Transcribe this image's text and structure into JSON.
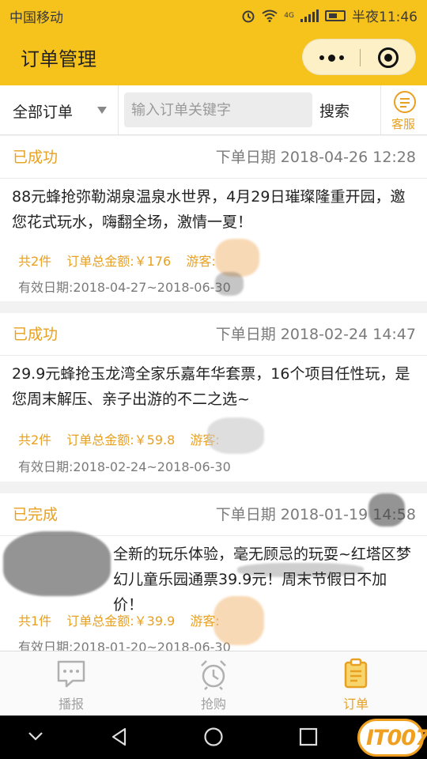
{
  "status_bar": {
    "carrier": "中国移动",
    "time": "半夜11:46",
    "network": "4G"
  },
  "header": {
    "title": "订单管理"
  },
  "filter": {
    "dropdown_label": "全部订单",
    "search_placeholder": "输入订单关键字",
    "search_button": "搜索",
    "service_label": "客服"
  },
  "orders": [
    {
      "status": "已成功",
      "date": "下单日期 2018-04-26 12:28",
      "description": "88元蜂抢弥勒湖泉温泉水世界，4月29日璀璨隆重开园，邀您花式玩水，嗨翻全场，激情一夏！",
      "count": "共2件",
      "total": "订单总金额:￥176",
      "guest": "游客:",
      "valid": "有效日期:2018-04-27~2018-06-30"
    },
    {
      "status": "已成功",
      "date": "下单日期 2018-02-24 14:47",
      "description": "29.9元蜂抢玉龙湾全家乐嘉年华套票，16个项目任性玩，是您周末解压、亲子出游的不二之选~",
      "count": "共2件",
      "total": "订单总金额:￥59.8",
      "guest": "游客:",
      "valid": "有效日期:2018-02-24~2018-06-30"
    },
    {
      "status": "已完成",
      "date": "下单日期 2018-01-19 14:58",
      "description": "全新的玩乐体验，毫无顾忌的玩耍~红塔区梦幻儿童乐园通票39.9元！周末节假日不加价！",
      "count": "共1件",
      "total": "订单总金额:￥39.9",
      "guest": "游客:",
      "valid": "有效日期:2018-01-20~2018-06-30"
    }
  ],
  "tabs": [
    {
      "label": "播报",
      "icon": "broadcast-icon",
      "active": false
    },
    {
      "label": "抢购",
      "icon": "alarm-clock-icon",
      "active": false
    },
    {
      "label": "订单",
      "icon": "order-clipboard-icon",
      "active": true
    }
  ],
  "watermark": {
    "text": "IT007"
  },
  "colors": {
    "brand_yellow": "#f6c21c",
    "accent_orange": "#e8a020",
    "muted_text": "#7a7a7a"
  }
}
